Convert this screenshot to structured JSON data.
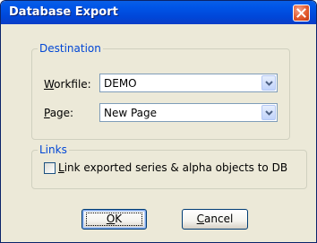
{
  "window": {
    "title": "Database Export"
  },
  "destination": {
    "legend": "Destination",
    "workfile": {
      "label_mnemonic": "W",
      "label_rest": "orkfile:",
      "value": "DEMO"
    },
    "page": {
      "label_mnemonic": "P",
      "label_rest": "age:",
      "value": "New Page"
    }
  },
  "links": {
    "legend": "Links",
    "checkbox": {
      "label_mnemonic": "L",
      "label_rest": "ink exported series & alpha objects to DB",
      "checked": false
    }
  },
  "buttons": {
    "ok": {
      "mnemonic": "O",
      "rest": "K"
    },
    "cancel": {
      "mnemonic": "C",
      "rest": "ancel"
    }
  },
  "colors": {
    "titlebar": "#0054e3",
    "dialog_background": "#ece9d8",
    "group_legend": "#0046d5",
    "close_button": "#e35b2e"
  },
  "icons": {
    "close": "close-icon",
    "dropdown": "chevron-down-icon"
  }
}
